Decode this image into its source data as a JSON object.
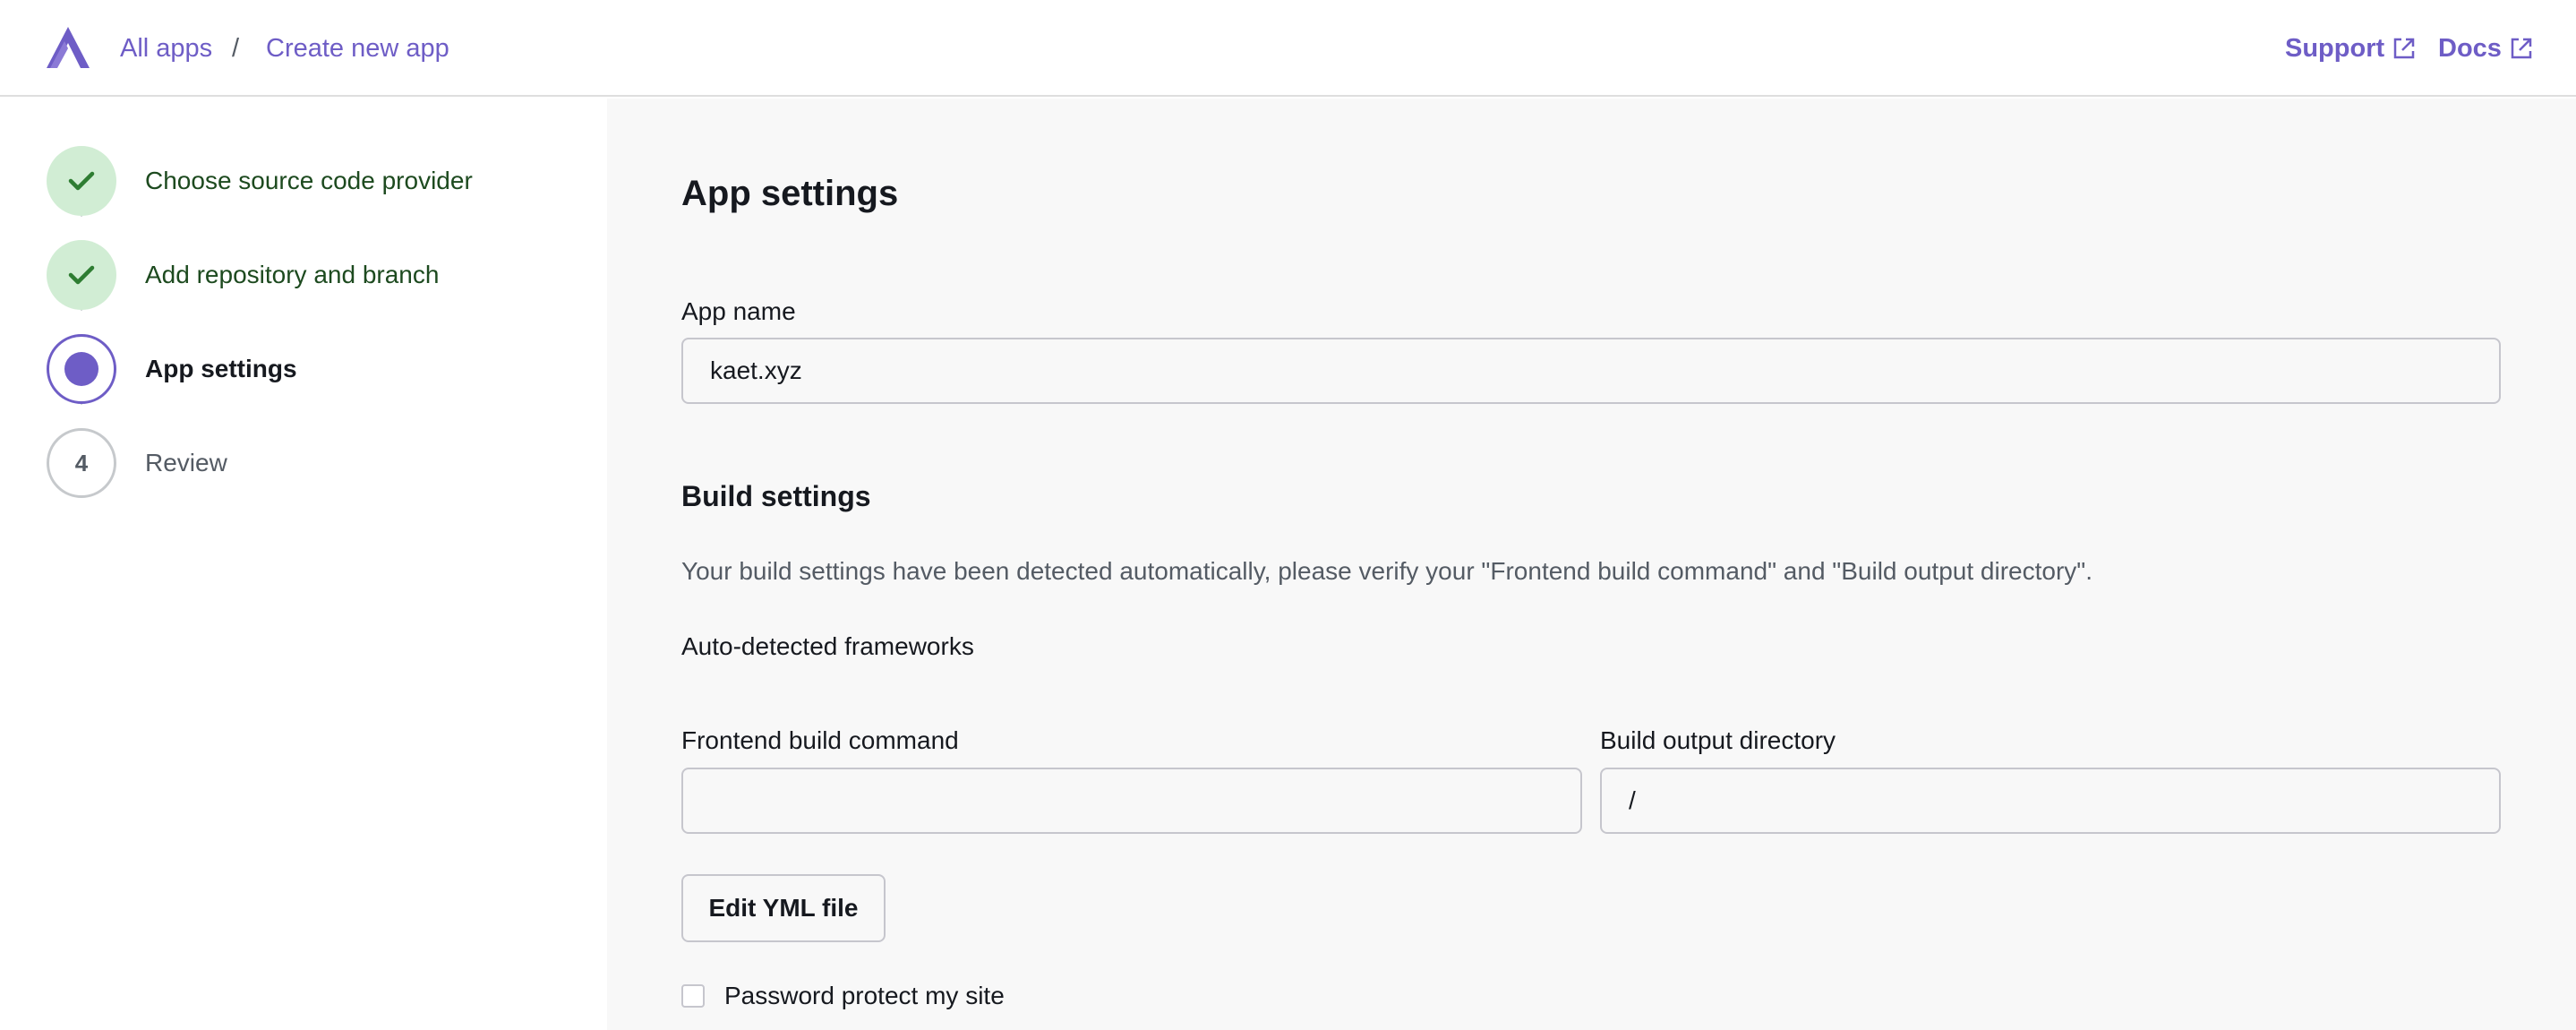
{
  "header": {
    "breadcrumb": [
      {
        "label": "All apps"
      },
      {
        "label": "Create new app"
      }
    ],
    "separator": "/",
    "links": {
      "support": "Support",
      "docs": "Docs"
    }
  },
  "steps": [
    {
      "label": "Choose source code provider",
      "state": "done"
    },
    {
      "label": "Add repository and branch",
      "state": "done"
    },
    {
      "label": "App settings",
      "state": "current"
    },
    {
      "label": "Review",
      "state": "todo",
      "number": "4"
    }
  ],
  "main": {
    "title": "App settings",
    "app_name": {
      "label": "App name",
      "value": "kaet.xyz"
    },
    "build_settings": {
      "title": "Build settings",
      "description": "Your build settings have been detected automatically, please verify your \"Frontend build command\" and \"Build output directory\".",
      "frameworks_label": "Auto-detected frameworks",
      "frontend_command": {
        "label": "Frontend build command",
        "value": ""
      },
      "output_dir": {
        "label": "Build output directory",
        "value": "/"
      },
      "edit_yml_button": "Edit YML file",
      "password_protect_label": "Password protect my site"
    }
  },
  "colors": {
    "accent": "#6e5dc6",
    "done_bg": "#d1edd4",
    "done_check": "#2e7d32"
  }
}
